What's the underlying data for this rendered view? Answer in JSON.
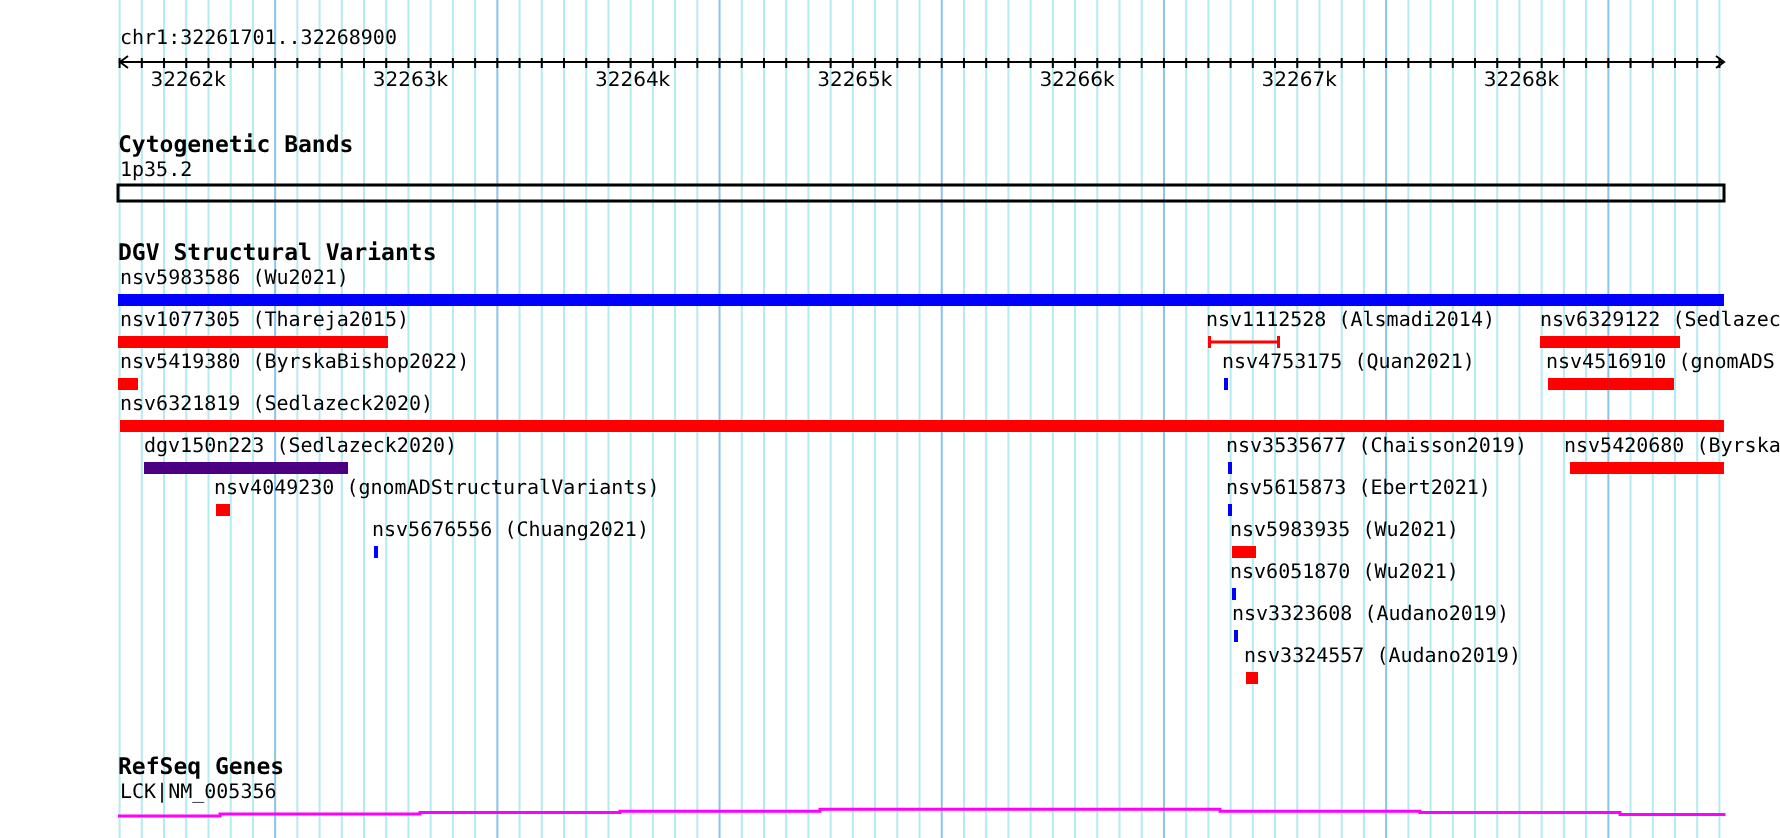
{
  "ruler": {
    "location": "chr1:32261701..32268900",
    "ticks": [
      "32262k",
      "32263k",
      "32264k",
      "32265k",
      "32266k",
      "32267k",
      "32268k"
    ]
  },
  "tracks": [
    {
      "title": "Cytogenetic Bands",
      "kind": "cytoband",
      "features": [
        {
          "label": "1p35.2"
        }
      ]
    },
    {
      "title": "DGV Structural Variants",
      "kind": "variants",
      "features": [
        {
          "label": "nsv5983586 (Wu2021)",
          "kind": "bar",
          "color": "#0000ff"
        },
        {
          "label": "nsv1077305 (Thareja2015)",
          "kind": "bar",
          "color": "#ff0000"
        },
        {
          "label": "nsv1112528 (Alsmadi2014)",
          "kind": "span",
          "color": "#ff0000"
        },
        {
          "label": "nsv6329122 (Sedlazec",
          "kind": "bar",
          "color": "#ff0000"
        },
        {
          "label": "nsv5419380 (ByrskaBishop2022)",
          "kind": "bar",
          "color": "#ff0000"
        },
        {
          "label": "nsv4753175 (Quan2021)",
          "kind": "bar",
          "color": "#0000ff"
        },
        {
          "label": "nsv4516910 (gnomADS",
          "kind": "bar",
          "color": "#ff0000"
        },
        {
          "label": "nsv6321819 (Sedlazeck2020)",
          "kind": "bar",
          "color": "#ff0000"
        },
        {
          "label": "dgv150n223 (Sedlazeck2020)",
          "kind": "bar",
          "color": "#4b0082"
        },
        {
          "label": "nsv3535677 (Chaisson2019)",
          "kind": "bar",
          "color": "#0000ff"
        },
        {
          "label": "nsv5420680 (Byrska",
          "kind": "bar",
          "color": "#ff0000"
        },
        {
          "label": "nsv4049230 (gnomADStructuralVariants)",
          "kind": "bar",
          "color": "#ff0000"
        },
        {
          "label": "nsv5615873 (Ebert2021)",
          "kind": "bar",
          "color": "#0000ff"
        },
        {
          "label": "nsv5676556 (Chuang2021)",
          "kind": "bar",
          "color": "#0000ff"
        },
        {
          "label": "nsv5983935 (Wu2021)",
          "kind": "bar",
          "color": "#ff0000"
        },
        {
          "label": "nsv6051870 (Wu2021)",
          "kind": "bar",
          "color": "#0000ff"
        },
        {
          "label": "nsv3323608 (Audano2019)",
          "kind": "bar",
          "color": "#0000ff"
        },
        {
          "label": "nsv3324557 (Audano2019)",
          "kind": "bar",
          "color": "#ff0000"
        }
      ]
    },
    {
      "title": "RefSeq Genes",
      "kind": "gene",
      "features": [
        {
          "label": "LCK|NM_005356"
        }
      ]
    }
  ]
}
